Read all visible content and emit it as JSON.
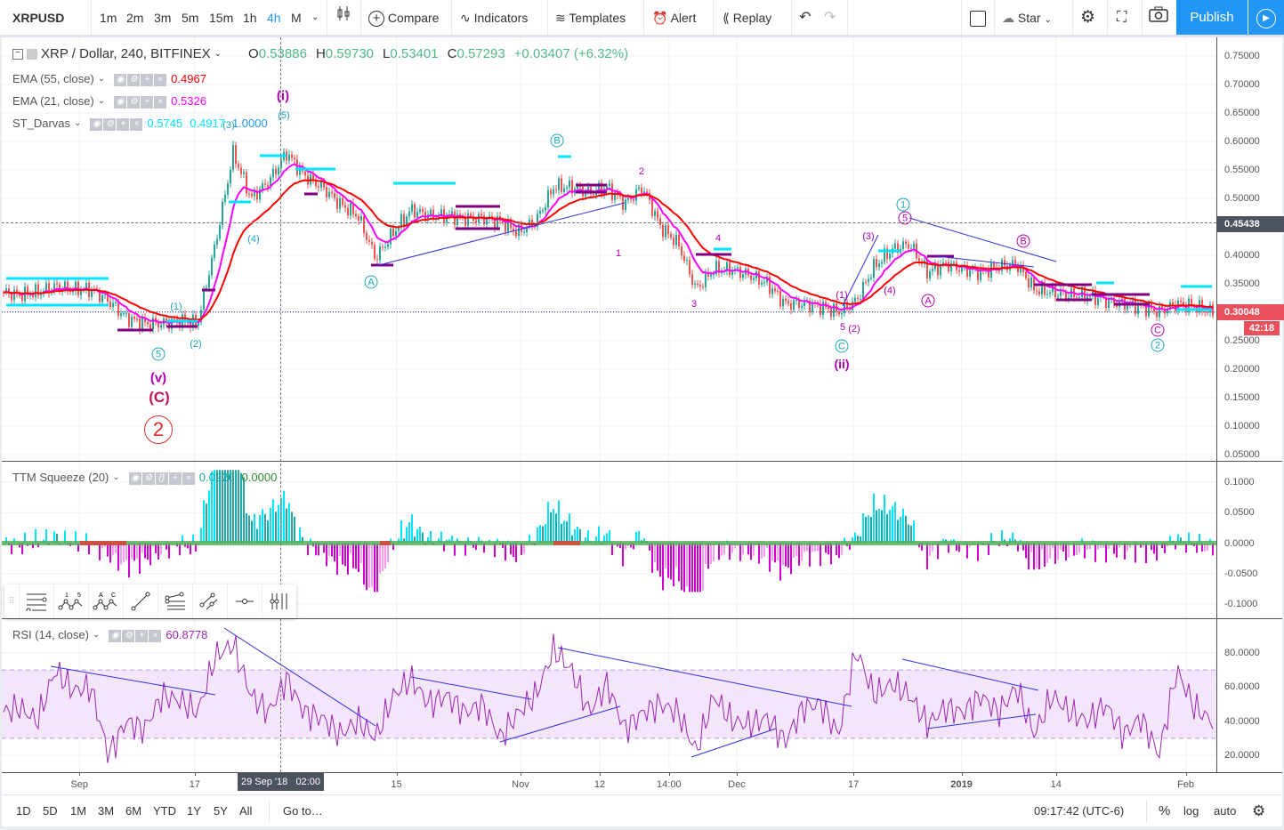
{
  "toolbar": {
    "symbol": "XRPUSD",
    "intervals": [
      "1m",
      "2m",
      "3m",
      "5m",
      "15m",
      "1h",
      "4h",
      "M"
    ],
    "active_interval": "4h",
    "compare": "Compare",
    "indicators": "Indicators",
    "templates": "Templates",
    "alert": "Alert",
    "replay": "Replay",
    "star": "Star",
    "publish": "Publish"
  },
  "main": {
    "title": "XRP / Dollar, 240, BITFINEX",
    "ohlc": {
      "o_label": "O",
      "o": "0.53886",
      "h_label": "H",
      "h": "0.59730",
      "l_label": "L",
      "l": "0.53401",
      "c_label": "C",
      "c": "0.57293",
      "change": "+0.03407 (+6.32%)"
    },
    "studies": [
      {
        "name": "EMA (55, close)",
        "values": [
          "0.4967"
        ],
        "colors": [
          "#ff0000"
        ]
      },
      {
        "name": "EMA (21, close)",
        "values": [
          "0.5326"
        ],
        "colors": [
          "#ff00ff"
        ]
      },
      {
        "name": "ST_Darvas",
        "values": [
          "0.5745",
          "0.4917",
          "1.0000"
        ],
        "colors": [
          "#00e5ff",
          "#00e5ff",
          "#2196f3"
        ]
      }
    ],
    "price_ticks": [
      "0.75000",
      "0.70000",
      "0.65000",
      "0.60000",
      "0.55000",
      "0.50000",
      "0.45000",
      "0.40000",
      "0.35000",
      "0.30000",
      "0.25000",
      "0.20000",
      "0.15000",
      "0.10000",
      "0.05000"
    ],
    "crosshair_price": "0.45438",
    "last_price": "0.30048",
    "countdown": "42:18",
    "wave_labels": [
      "(i)",
      "(5)",
      "(3)",
      "(4)",
      "(1)",
      "(2)",
      "5",
      "(v)",
      "(C)",
      "2",
      "A",
      "B",
      "2",
      "1",
      "4",
      "3",
      "5",
      "(2)",
      "C",
      "(ii)",
      "(1)",
      "(3)",
      "(4)",
      "1",
      "5",
      "A",
      "B",
      "C",
      "2"
    ]
  },
  "ttm": {
    "name": "TTM Squeeze (20)",
    "values": [
      "0.0220",
      "0.0000"
    ],
    "ticks": [
      "0.1000",
      "0.0500",
      "0.0000",
      "-0.0500",
      "-0.1000"
    ]
  },
  "rsi": {
    "name": "RSI (14, close)",
    "value": "60.8778",
    "ticks": [
      "80.0000",
      "60.0000",
      "40.0000",
      "20.0000"
    ]
  },
  "time_axis": {
    "labels": [
      "Sep",
      "17",
      "15",
      "Nov",
      "12",
      "14:00",
      "Dec",
      "17",
      "2019",
      "14",
      "Feb"
    ],
    "crosshair": "29 Sep '18   02:00"
  },
  "bottom": {
    "ranges": [
      "1D",
      "5D",
      "1M",
      "3M",
      "6M",
      "YTD",
      "1Y",
      "5Y",
      "All"
    ],
    "goto": "Go to…",
    "clock": "09:17:42 (UTC-6)",
    "pct": "%",
    "log": "log",
    "auto": "auto"
  },
  "colors": {
    "accent": "#2196f3",
    "up": "#26a69a",
    "down": "#ef5350",
    "ema55": "#ff0000",
    "ema21": "#ff00ff",
    "darvas_top": "#00e5ff",
    "darvas_bottom": "#800080",
    "last_price": "#e8505b",
    "rsi": "#9c27b0"
  },
  "chart_data": {
    "type": "candlestick",
    "x_start_day": 1.23,
    "x_step_days": 2.47,
    "close": [
      0.335,
      0.33,
      0.335,
      0.345,
      0.34,
      0.34,
      0.32,
      0.29,
      0.28,
      0.28,
      0.285,
      0.28,
      0.42,
      0.58,
      0.5,
      0.53,
      0.58,
      0.54,
      0.52,
      0.49,
      0.47,
      0.395,
      0.44,
      0.48,
      0.47,
      0.47,
      0.465,
      0.465,
      0.46,
      0.44,
      0.46,
      0.52,
      0.52,
      0.51,
      0.52,
      0.49,
      0.52,
      0.45,
      0.42,
      0.34,
      0.375,
      0.375,
      0.365,
      0.35,
      0.315,
      0.315,
      0.31,
      0.3,
      0.32,
      0.38,
      0.41,
      0.42,
      0.37,
      0.385,
      0.375,
      0.37,
      0.38,
      0.385,
      0.34,
      0.335,
      0.33,
      0.33,
      0.32,
      0.315,
      0.31,
      0.3,
      0.315,
      0.31,
      0.3
    ],
    "rsi": [
      45,
      48,
      40,
      70,
      58,
      60,
      20,
      40,
      35,
      55,
      52,
      45,
      78,
      85,
      55,
      45,
      65,
      45,
      42,
      32,
      40,
      30,
      55,
      65,
      50,
      55,
      45,
      50,
      30,
      45,
      55,
      82,
      70,
      45,
      62,
      35,
      45,
      50,
      45,
      22,
      55,
      40,
      38,
      42,
      28,
      48,
      50,
      32,
      82,
      55,
      62,
      55,
      38,
      48,
      45,
      55,
      45,
      60,
      32,
      55,
      45,
      40,
      50,
      32,
      42,
      20,
      70,
      48,
      40
    ],
    "ylim": [
      0.05,
      0.75
    ],
    "ttm_ylim": [
      -0.1,
      0.1
    ],
    "rsi_ylim": [
      10,
      95
    ],
    "rsi_band": [
      30,
      70
    ]
  }
}
